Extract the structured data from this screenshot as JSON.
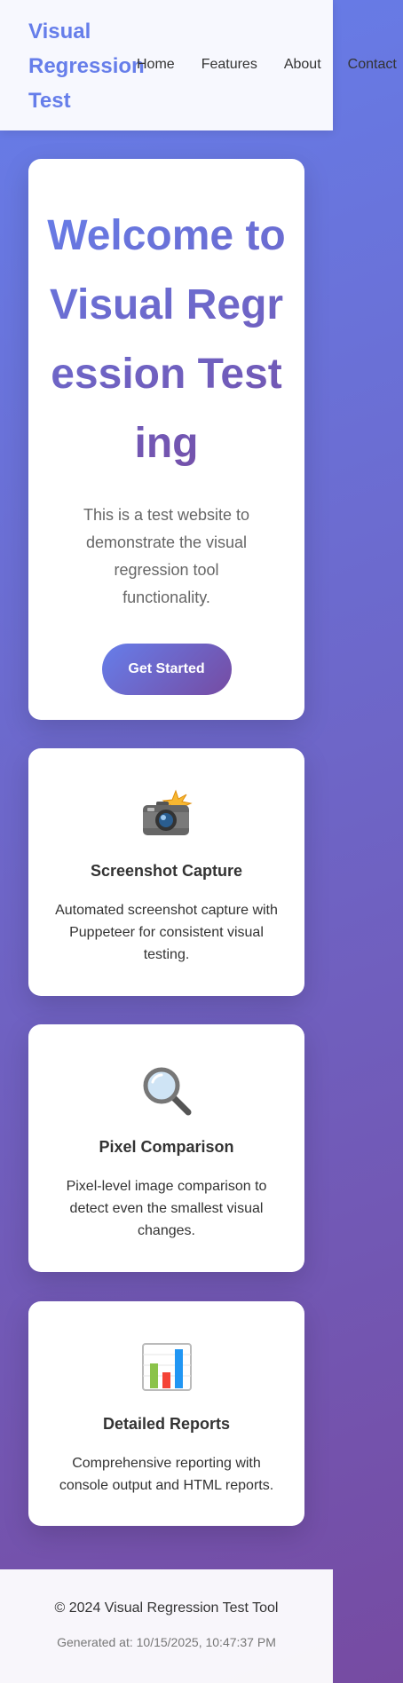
{
  "header": {
    "logo": "Visual Regression Test",
    "nav": [
      "Home",
      "Features",
      "About",
      "Contact"
    ]
  },
  "hero": {
    "title": "Welcome to Visual Regression Testing",
    "text": "This is a test website to demonstrate the visual regression tool functionality.",
    "cta_label": "Get Started"
  },
  "features": [
    {
      "icon": "camera-flash-icon",
      "title": "Screenshot Capture",
      "text": "Automated screenshot capture with Puppeteer for consistent visual testing."
    },
    {
      "icon": "magnifying-glass-icon",
      "title": "Pixel Comparison",
      "text": "Pixel-level image comparison to detect even the smallest visual changes."
    },
    {
      "icon": "bar-chart-icon",
      "title": "Detailed Reports",
      "text": "Comprehensive reporting with console output and HTML reports."
    }
  ],
  "footer": {
    "copyright": "© 2024 Visual Regression Test Tool",
    "generated": "Generated at: 10/15/2025, 10:47:37 PM"
  },
  "colors": {
    "accent": "#667eea",
    "accent_dark": "#764ba2"
  }
}
